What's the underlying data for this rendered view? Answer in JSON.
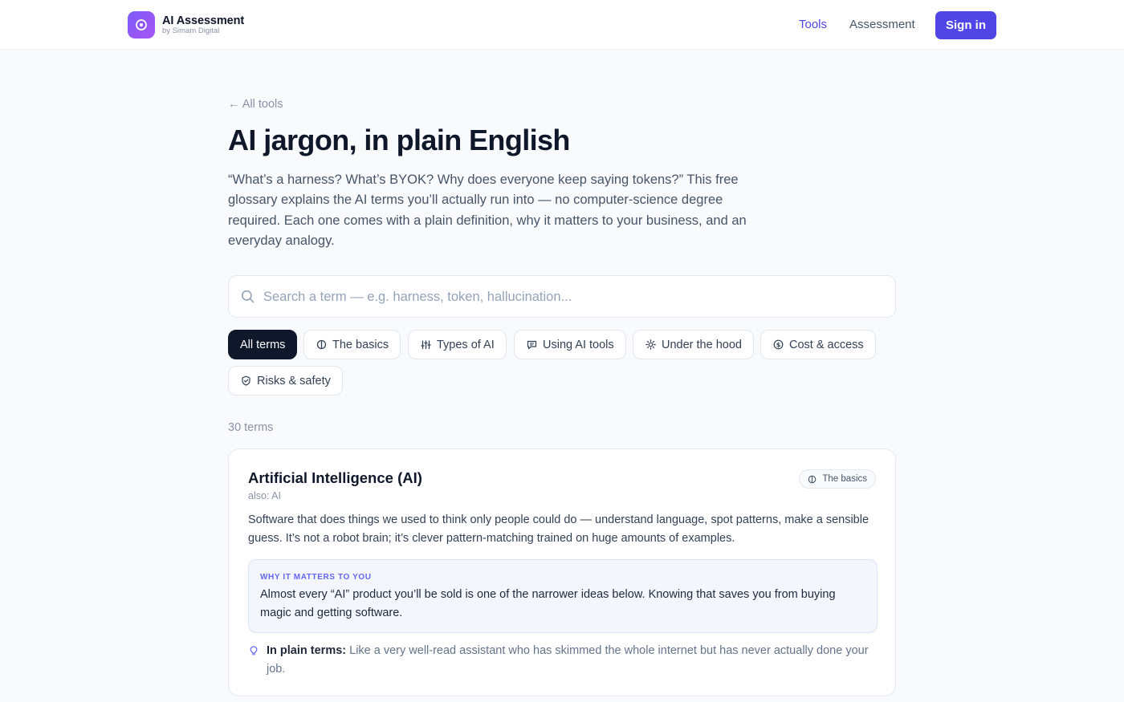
{
  "header": {
    "brand_title": "AI Assessment",
    "brand_subtitle": "by Simam Digital",
    "nav": [
      {
        "label": "Tools",
        "active": true
      },
      {
        "label": "Assessment",
        "active": false
      }
    ],
    "signin_label": "Sign in"
  },
  "page": {
    "back_label": "← All tools",
    "title": "AI jargon, in plain English",
    "intro": "“What’s a harness? What’s BYOK? Why does everyone keep saying tokens?” This free glossary explains the AI terms you’ll actually run into — no computer-science degree required. Each one comes with a plain definition, why it matters to your business, and an everyday analogy."
  },
  "search": {
    "placeholder": "Search a term — e.g. harness, token, hallucination...",
    "value": ""
  },
  "filters": [
    {
      "label": "All terms",
      "icon": "",
      "active": true
    },
    {
      "label": "The basics",
      "icon": "brain-icon",
      "active": false
    },
    {
      "label": "Types of AI",
      "icon": "sliders-icon",
      "active": false
    },
    {
      "label": "Using AI tools",
      "icon": "chat-icon",
      "active": false
    },
    {
      "label": "Under the hood",
      "icon": "gear-icon",
      "active": false
    },
    {
      "label": "Cost & access",
      "icon": "dollar-icon",
      "active": false
    },
    {
      "label": "Risks & safety",
      "icon": "shield-icon",
      "active": false
    }
  ],
  "term_count": "30 terms",
  "terms": [
    {
      "title": "Artificial Intelligence (AI)",
      "also": "also: AI",
      "category": "The basics",
      "category_icon": "brain-icon",
      "definition": "Software that does things we used to think only people could do — understand language, spot patterns, make a sensible guess. It’s not a robot brain; it’s clever pattern-matching trained on huge amounts of examples.",
      "why_label": "WHY IT MATTERS TO YOU",
      "why_text": "Almost every “AI” product you’ll be sold is one of the narrower ideas below. Knowing that saves you from buying magic and getting software.",
      "analogy_label": "In plain terms:",
      "analogy_text": " Like a very well-read assistant who has skimmed the whole internet but has never actually done your job."
    }
  ],
  "colors": {
    "accent": "#4f46e5",
    "brand_gradient_start": "#7c5cf5",
    "brand_gradient_end": "#a855f7",
    "active_chip": "#0f172a",
    "why_label": "#6366f1"
  }
}
